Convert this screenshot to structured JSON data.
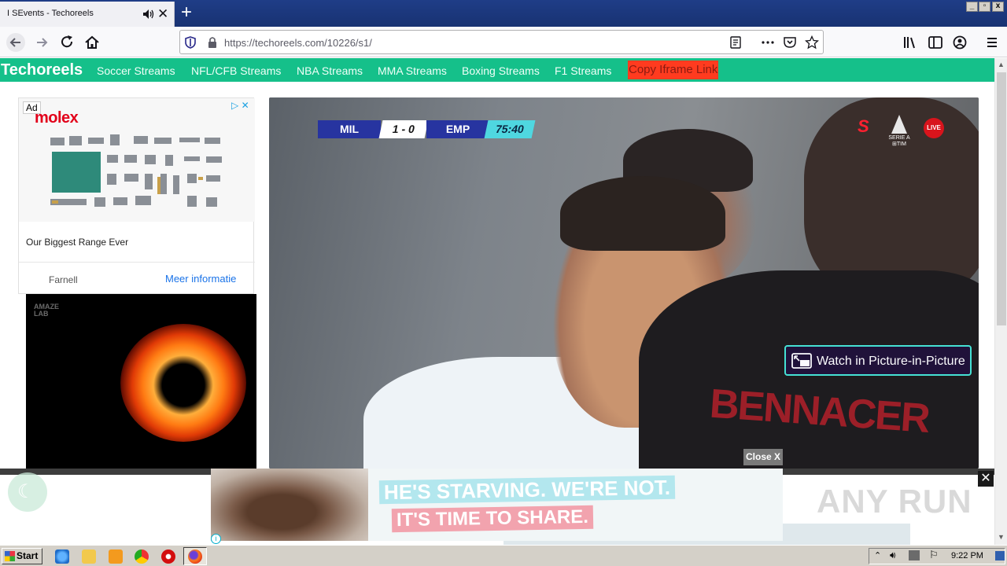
{
  "browser": {
    "tab_title": "I SEvents - Techoreels",
    "new_tab_glyph": "+",
    "tab_close_glyph": "✕",
    "url": "https://techoreels.com/10226/s1/",
    "icons": [
      "back-icon",
      "forward-icon",
      "reload-icon",
      "home-icon",
      "shield-icon",
      "lock-icon",
      "reader-view-icon",
      "more-icon",
      "pocket-icon",
      "bookmark-star-icon",
      "library-icon",
      "sidebar-icon",
      "account-icon",
      "menu-icon"
    ]
  },
  "site": {
    "brand": "Techoreels",
    "nav": [
      "Soccer Streams",
      "NFL/CFB Streams",
      "NBA Streams",
      "MMA Streams",
      "Boxing Streams",
      "F1 Streams"
    ],
    "copy_iframe": "Copy Iframe Link",
    "accent": "#15c08a"
  },
  "ad": {
    "badge": "Ad",
    "logo": "molex",
    "headline": "Our Biggest Range Ever",
    "advertiser": "Farnell",
    "cta": "Meer informatie"
  },
  "side_ad2": {
    "logo": "AMAZE\nLAB"
  },
  "video": {
    "home": "MIL",
    "score": "1 - 0",
    "away": "EMP",
    "clock": "75:40",
    "live": "LIVE",
    "league_small": "SERIE A\n⊞TIM",
    "shirt_text": "BENNACER",
    "pip_label": "Watch in Picture-in-Picture",
    "close_label": "Close X"
  },
  "banner": {
    "line1_a": "HE'S STARVING.",
    "line1_b": "WE'RE NOT.",
    "line2": "IT'S TIME TO SHARE.",
    "close_glyph": "✕",
    "info_glyph": "i",
    "watermark": "ANY RUN"
  },
  "taskbar": {
    "start": "Start",
    "clock": "9:22 PM"
  }
}
